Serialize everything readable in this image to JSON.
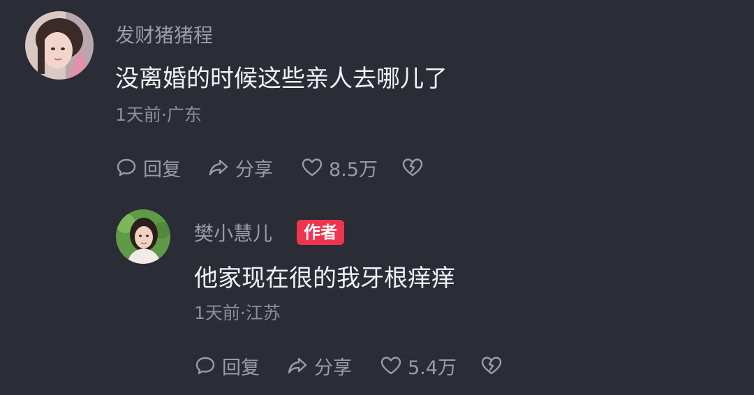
{
  "comments": [
    {
      "username": "发财猪猪程",
      "text": "没离婚的时候这些亲人去哪儿了",
      "meta": "1天前·广东",
      "actions": {
        "reply_label": "回复",
        "share_label": "分享",
        "like_count": "8.5万"
      }
    },
    {
      "username": "樊小慧儿",
      "badge": "作者",
      "text": "他家现在很的我牙根痒痒",
      "meta": "1天前·江苏",
      "actions": {
        "reply_label": "回复",
        "share_label": "分享",
        "like_count": "5.4万"
      }
    }
  ],
  "colors": {
    "background": "#2a2c36",
    "author_badge": "#f0344f",
    "secondary_text": "#9a9ba6"
  },
  "icons": [
    "comment-bubble-icon",
    "share-icon",
    "heart-icon",
    "broken-heart-icon"
  ]
}
